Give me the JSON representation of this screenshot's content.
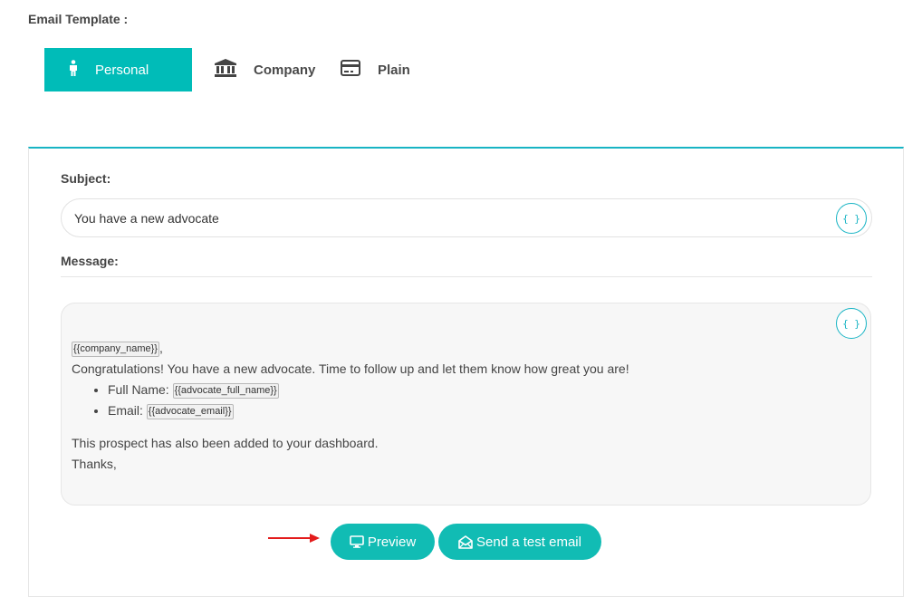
{
  "section": {
    "title": "Email Template :"
  },
  "tabs": [
    {
      "label": "Personal",
      "icon": "person-icon",
      "active": true
    },
    {
      "label": "Company",
      "icon": "bank-icon",
      "active": false
    },
    {
      "label": "Plain",
      "icon": "card-icon",
      "active": false
    }
  ],
  "subject": {
    "label": "Subject:",
    "value": "You have a new advocate",
    "var_button": "{ }"
  },
  "message": {
    "label": "Message:",
    "var_button": "{ }",
    "greeting_tag": "{{company_name}}",
    "greeting_suffix": ",",
    "intro": "Congratulations! You have a new advocate. Time to follow up and let them know how great you are!",
    "items": [
      {
        "label": "Full Name:",
        "tag": "{{advocate_full_name}}"
      },
      {
        "label": "Email:",
        "tag": "{{advocate_email}}"
      }
    ],
    "closing": "This prospect has also been added to your dashboard.",
    "signoff": "Thanks,"
  },
  "actions": {
    "preview": "Preview",
    "preview_icon": "monitor-icon",
    "test_email": "Send a test email",
    "test_email_icon": "envelope-open-icon"
  },
  "colors": {
    "accent": "#00bcb8",
    "panel_border": "#18b4c4",
    "arrow": "#e31b1b"
  }
}
